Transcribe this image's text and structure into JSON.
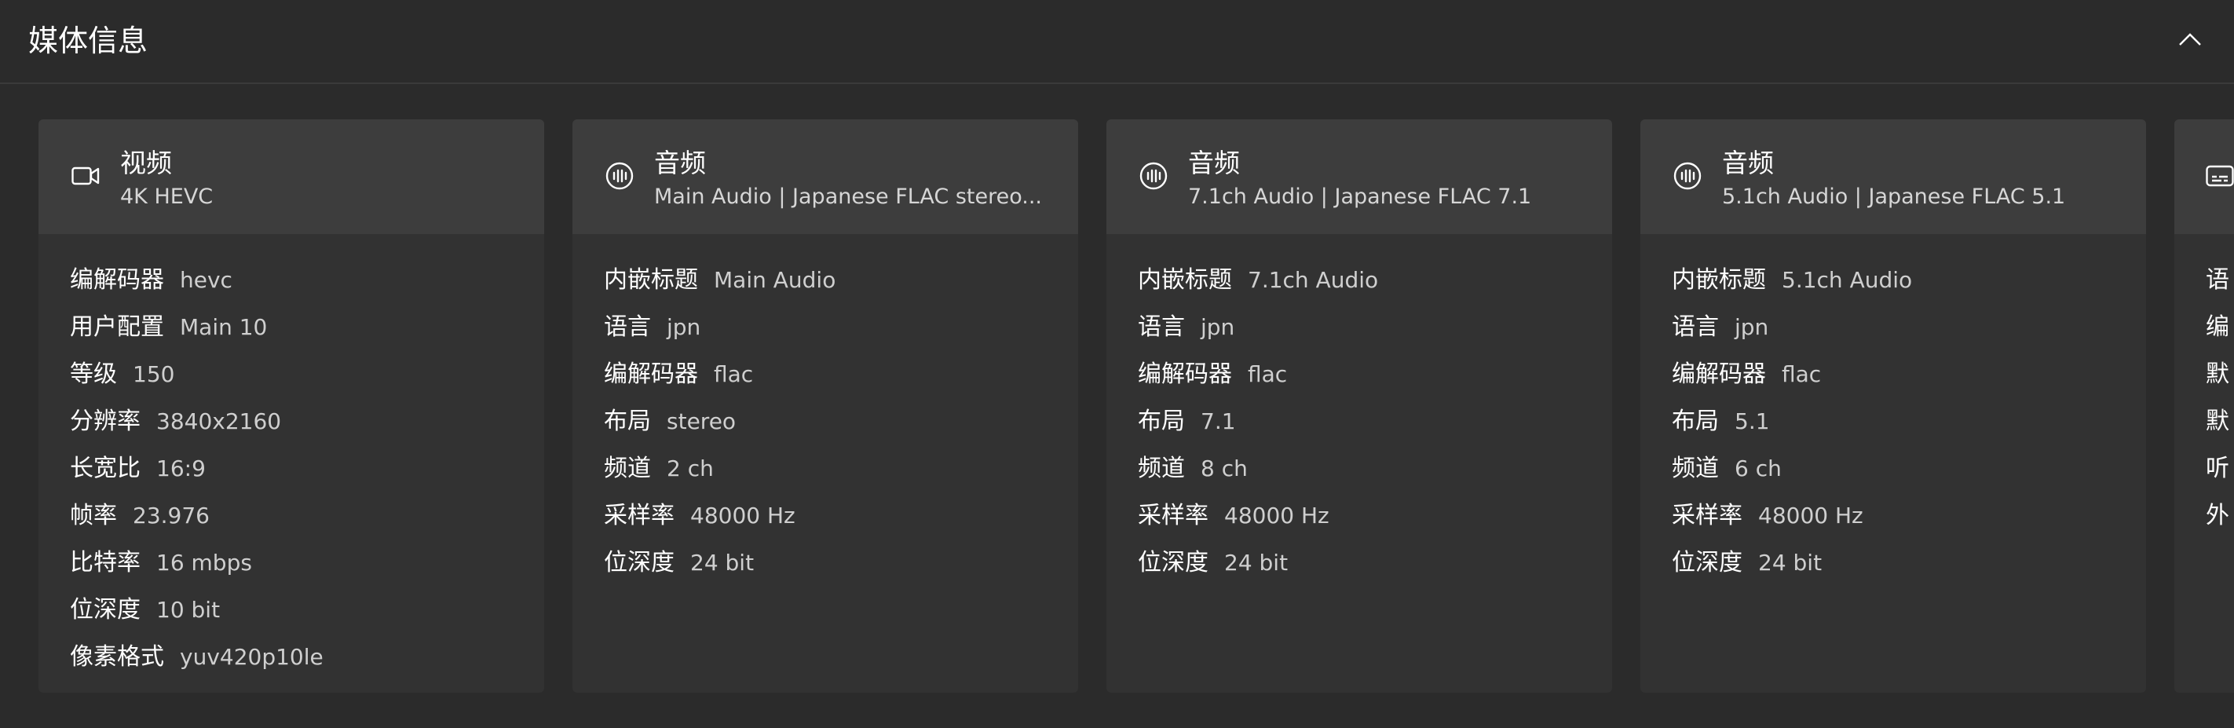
{
  "header": {
    "title": "媒体信息",
    "collapse_icon": "chevron-up-icon"
  },
  "streams": [
    {
      "icon": "video-icon",
      "title": "视频",
      "subtitle": "4K HEVC",
      "props": [
        {
          "label": "编解码器",
          "value": "hevc"
        },
        {
          "label": "用户配置",
          "value": "Main 10"
        },
        {
          "label": "等级",
          "value": "150"
        },
        {
          "label": "分辨率",
          "value": "3840x2160"
        },
        {
          "label": "长宽比",
          "value": "16:9"
        },
        {
          "label": "帧率",
          "value": "23.976"
        },
        {
          "label": "比特率",
          "value": "16 mbps"
        },
        {
          "label": "位深度",
          "value": "10 bit"
        },
        {
          "label": "像素格式",
          "value": "yuv420p10le"
        }
      ]
    },
    {
      "icon": "audio-icon",
      "title": "音频",
      "subtitle": "Main Audio | Japanese FLAC stereo...",
      "props": [
        {
          "label": "内嵌标题",
          "value": "Main Audio"
        },
        {
          "label": "语言",
          "value": "jpn"
        },
        {
          "label": "编解码器",
          "value": "flac"
        },
        {
          "label": "布局",
          "value": "stereo"
        },
        {
          "label": "频道",
          "value": "2 ch"
        },
        {
          "label": "采样率",
          "value": "48000 Hz"
        },
        {
          "label": "位深度",
          "value": "24 bit"
        }
      ]
    },
    {
      "icon": "audio-icon",
      "title": "音频",
      "subtitle": "7.1ch Audio | Japanese FLAC 7.1",
      "props": [
        {
          "label": "内嵌标题",
          "value": "7.1ch Audio"
        },
        {
          "label": "语言",
          "value": "jpn"
        },
        {
          "label": "编解码器",
          "value": "flac"
        },
        {
          "label": "布局",
          "value": "7.1"
        },
        {
          "label": "频道",
          "value": "8 ch"
        },
        {
          "label": "采样率",
          "value": "48000 Hz"
        },
        {
          "label": "位深度",
          "value": "24 bit"
        }
      ]
    },
    {
      "icon": "audio-icon",
      "title": "音频",
      "subtitle": "5.1ch Audio | Japanese FLAC 5.1",
      "props": [
        {
          "label": "内嵌标题",
          "value": "5.1ch Audio"
        },
        {
          "label": "语言",
          "value": "jpn"
        },
        {
          "label": "编解码器",
          "value": "flac"
        },
        {
          "label": "布局",
          "value": "5.1"
        },
        {
          "label": "频道",
          "value": "6 ch"
        },
        {
          "label": "采样率",
          "value": "48000 Hz"
        },
        {
          "label": "位深度",
          "value": "24 bit"
        }
      ]
    },
    {
      "icon": "subtitle-icon",
      "title": "",
      "subtitle": "",
      "props": [
        {
          "label": "语",
          "value": ""
        },
        {
          "label": "编",
          "value": ""
        },
        {
          "label": "默",
          "value": ""
        },
        {
          "label": "默",
          "value": ""
        },
        {
          "label": "听",
          "value": ""
        },
        {
          "label": "外",
          "value": ""
        }
      ]
    }
  ]
}
